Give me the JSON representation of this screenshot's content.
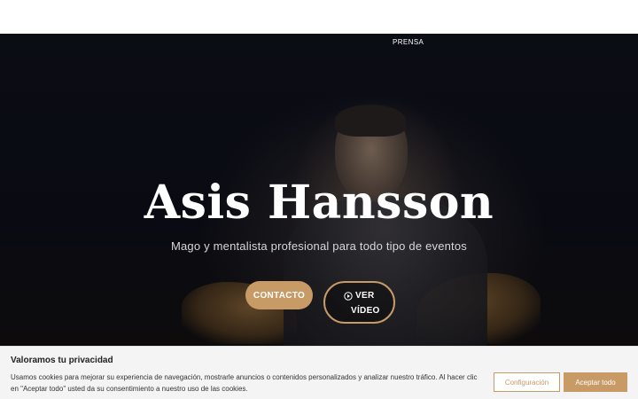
{
  "nav": {
    "items": [
      {
        "label": "PRENSA"
      }
    ]
  },
  "hero": {
    "title": "Asis Hansson",
    "subtitle": "Mago y mentalista profesional para todo tipo de eventos",
    "buttons": {
      "contact_label": "CONTACTO",
      "video_label_line1": "VER",
      "video_label_line2": "VÍDEO",
      "video_icon": "play-circle-icon"
    }
  },
  "cookie_banner": {
    "title": "Valoramos tu privacidad",
    "text": "Usamos cookies para mejorar su experiencia de navegación, mostrarle anuncios o contenidos personalizados y analizar nuestro tráfico. Al hacer clic en \"Aceptar todo\" usted da su consentimiento a nuestro uso de las cookies.",
    "config_label": "Configuración",
    "accept_label": "Aceptar todo"
  },
  "colors": {
    "accent": "#c79a66",
    "hero_bg": "#0b0d15",
    "banner_bg": "#f4f4f4"
  }
}
